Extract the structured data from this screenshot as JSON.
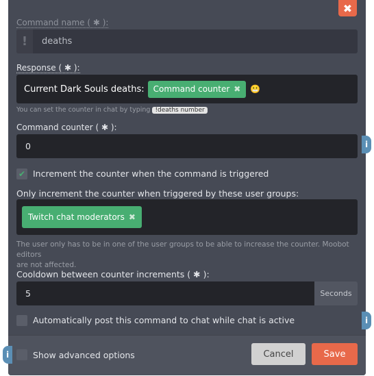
{
  "close_label": "✖",
  "command_name": {
    "label": "Command name ( ✱ ):",
    "prefix": "!",
    "value": "deaths"
  },
  "response": {
    "label": "Response ( ✱ ):",
    "text": "Current Dark Souls deaths:",
    "tag": "Command counter",
    "tag_remove": "✖",
    "emoji": "😬",
    "hint": "You can set the counter in chat by typing",
    "hint_code": "!deaths number"
  },
  "counter": {
    "label": "Command counter ( ✱ ):",
    "value": "0"
  },
  "increment": {
    "label": "Increment the counter when the command is triggered",
    "checked": true,
    "check": "✔"
  },
  "groups": {
    "label": "Only increment the counter when triggered by these user groups:",
    "tag": "Twitch chat moderators",
    "tag_remove": "✖",
    "help1": "The user only has to be in one of the user groups to be able to increase the counter. Moobot editors",
    "help2": "are not affected."
  },
  "cooldown": {
    "label": "Cooldown between counter increments ( ✱ ):",
    "value": "5",
    "unit": "Seconds"
  },
  "autopost": {
    "label": "Automatically post this command to chat while chat is active",
    "checked": false
  },
  "advanced": {
    "label": "Show advanced options",
    "checked": false
  },
  "info_glyph": "i",
  "buttons": {
    "cancel": "Cancel",
    "save": "Save"
  },
  "colors": {
    "accent": "#e8694a",
    "tag": "#48ae72",
    "info": "#5b8fb5",
    "modal": "#464a55"
  }
}
